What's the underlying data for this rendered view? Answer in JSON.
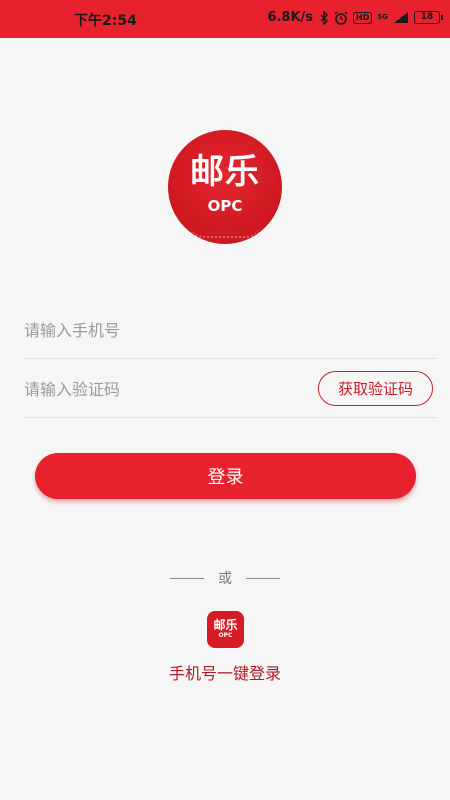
{
  "status_bar": {
    "time": "下午2:54",
    "speed": "6.8K/s",
    "icons": [
      "bluetooth-icon",
      "alarm-icon",
      "hd-icon",
      "5g-icon",
      "signal-icon",
      "battery-icon"
    ],
    "hd": "HD",
    "network": "5G",
    "battery": "18"
  },
  "logo": {
    "title": "邮乐",
    "subtitle": "OPC"
  },
  "form": {
    "phone_placeholder": "请输入手机号",
    "code_placeholder": "请输入验证码",
    "code_button": "获取验证码",
    "login_button": "登录"
  },
  "divider": {
    "text": "或"
  },
  "one_key": {
    "icon_title": "邮乐",
    "icon_subtitle": "OPC",
    "label": "手机号一键登录"
  },
  "colors": {
    "accent": "#e8212e",
    "accent_dark": "#c7202b",
    "background": "#f6f6f6"
  }
}
